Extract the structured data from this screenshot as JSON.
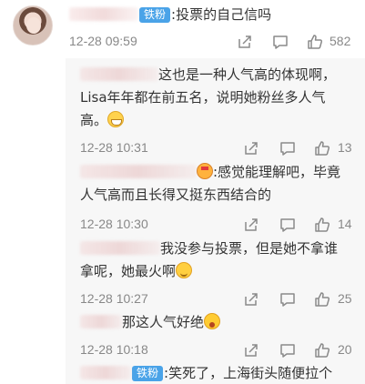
{
  "main_comment": {
    "badge": "铁粉",
    "text": ":投票的自己信吗",
    "time": "12-28 09:59",
    "likes": "582"
  },
  "replies": [
    {
      "line1": "这也是一种人气高的体现啊，",
      "line2": "Lisa年年都在前五名，说明她粉丝多人气",
      "line3": "高。",
      "emoji": "grin-emoji",
      "time": "12-28 10:31",
      "likes": "13"
    },
    {
      "line1": ":感觉能理解吧，毕竟",
      "line2": "人气高而且长得又挺东西结合的",
      "emoji": "crown-emoji",
      "time": "12-28 10:30",
      "likes": "14"
    },
    {
      "line1": "我没参与投票，但是她不拿谁",
      "line2": "拿呢，她最火啊",
      "emoji": "smile-emoji",
      "time": "12-28 10:27",
      "likes": "25"
    },
    {
      "line1": "那这人气好绝",
      "emoji": "wow-emoji",
      "time": "12-28 10:18",
      "likes": "20"
    },
    {
      "badge": "铁粉",
      "line1": ":笑死了，上海街头随便拉个"
    }
  ],
  "colors": {
    "badge": "#4aa3e8",
    "meta_text": "#888888",
    "icon": "#8a8a8a",
    "reply_bg": "#f7f7f7"
  },
  "icons": [
    "share-icon",
    "comment-icon",
    "like-icon"
  ]
}
